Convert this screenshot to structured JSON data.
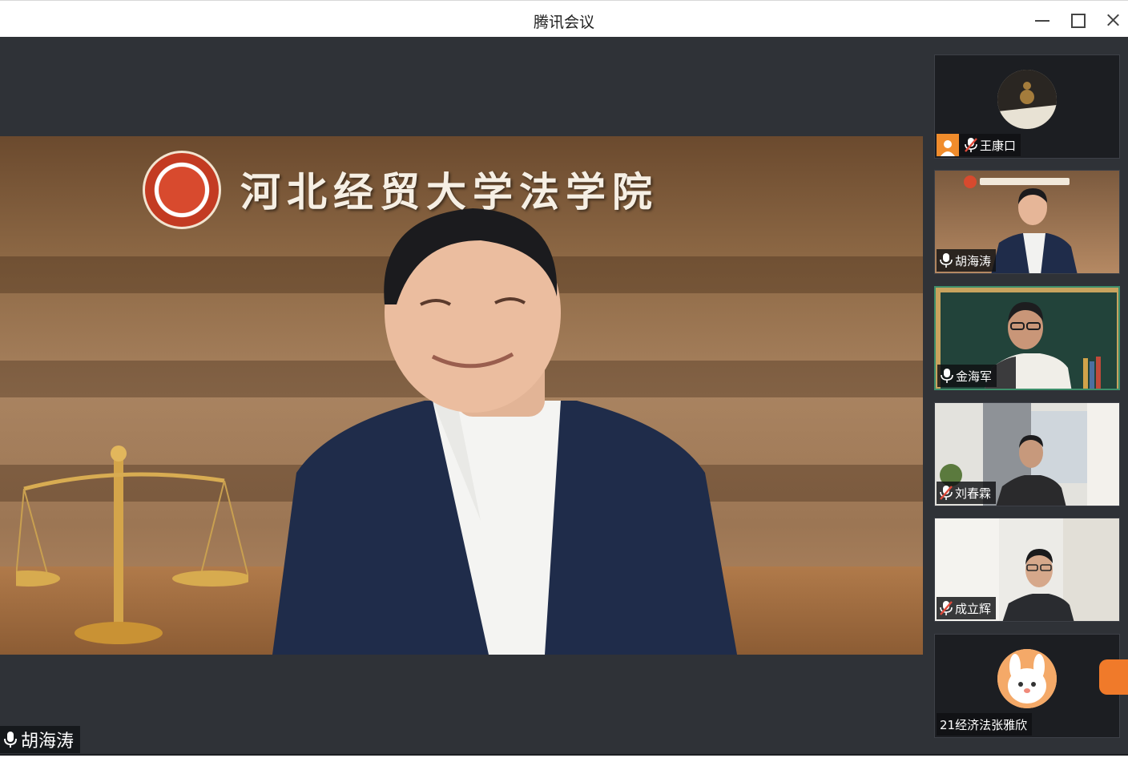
{
  "window": {
    "title": "腾讯会议",
    "controls": [
      "minimize-icon",
      "maximize-icon",
      "close-icon"
    ]
  },
  "main_video": {
    "speaker_name": "胡海涛",
    "banner_text": "河北经贸大学法学院",
    "mic_icon": "microphone-icon"
  },
  "participants": [
    {
      "name": "王康口",
      "video": false,
      "avatar": "gourd-photo",
      "muted": true,
      "host_badge": "person-icon"
    },
    {
      "name": "胡海涛",
      "video": true,
      "muted": false,
      "mic_icon": "microphone-icon"
    },
    {
      "name": "金海军",
      "video": true,
      "muted": false,
      "mic_icon": "microphone-icon",
      "active": true
    },
    {
      "name": "刘春霖",
      "video": true,
      "muted": true,
      "mic_icon": "mic-muted-icon"
    },
    {
      "name": "成立辉",
      "video": true,
      "muted": true,
      "mic_icon": "mic-muted-icon"
    },
    {
      "name": "21经济法张雅欣",
      "video": false,
      "avatar": "bunny-cartoon"
    }
  ],
  "colors": {
    "stage_bg": "#2f3237",
    "active_border": "#3e8f6b",
    "muted_red": "#e04a3a",
    "host_badge": "#f08c2c"
  }
}
